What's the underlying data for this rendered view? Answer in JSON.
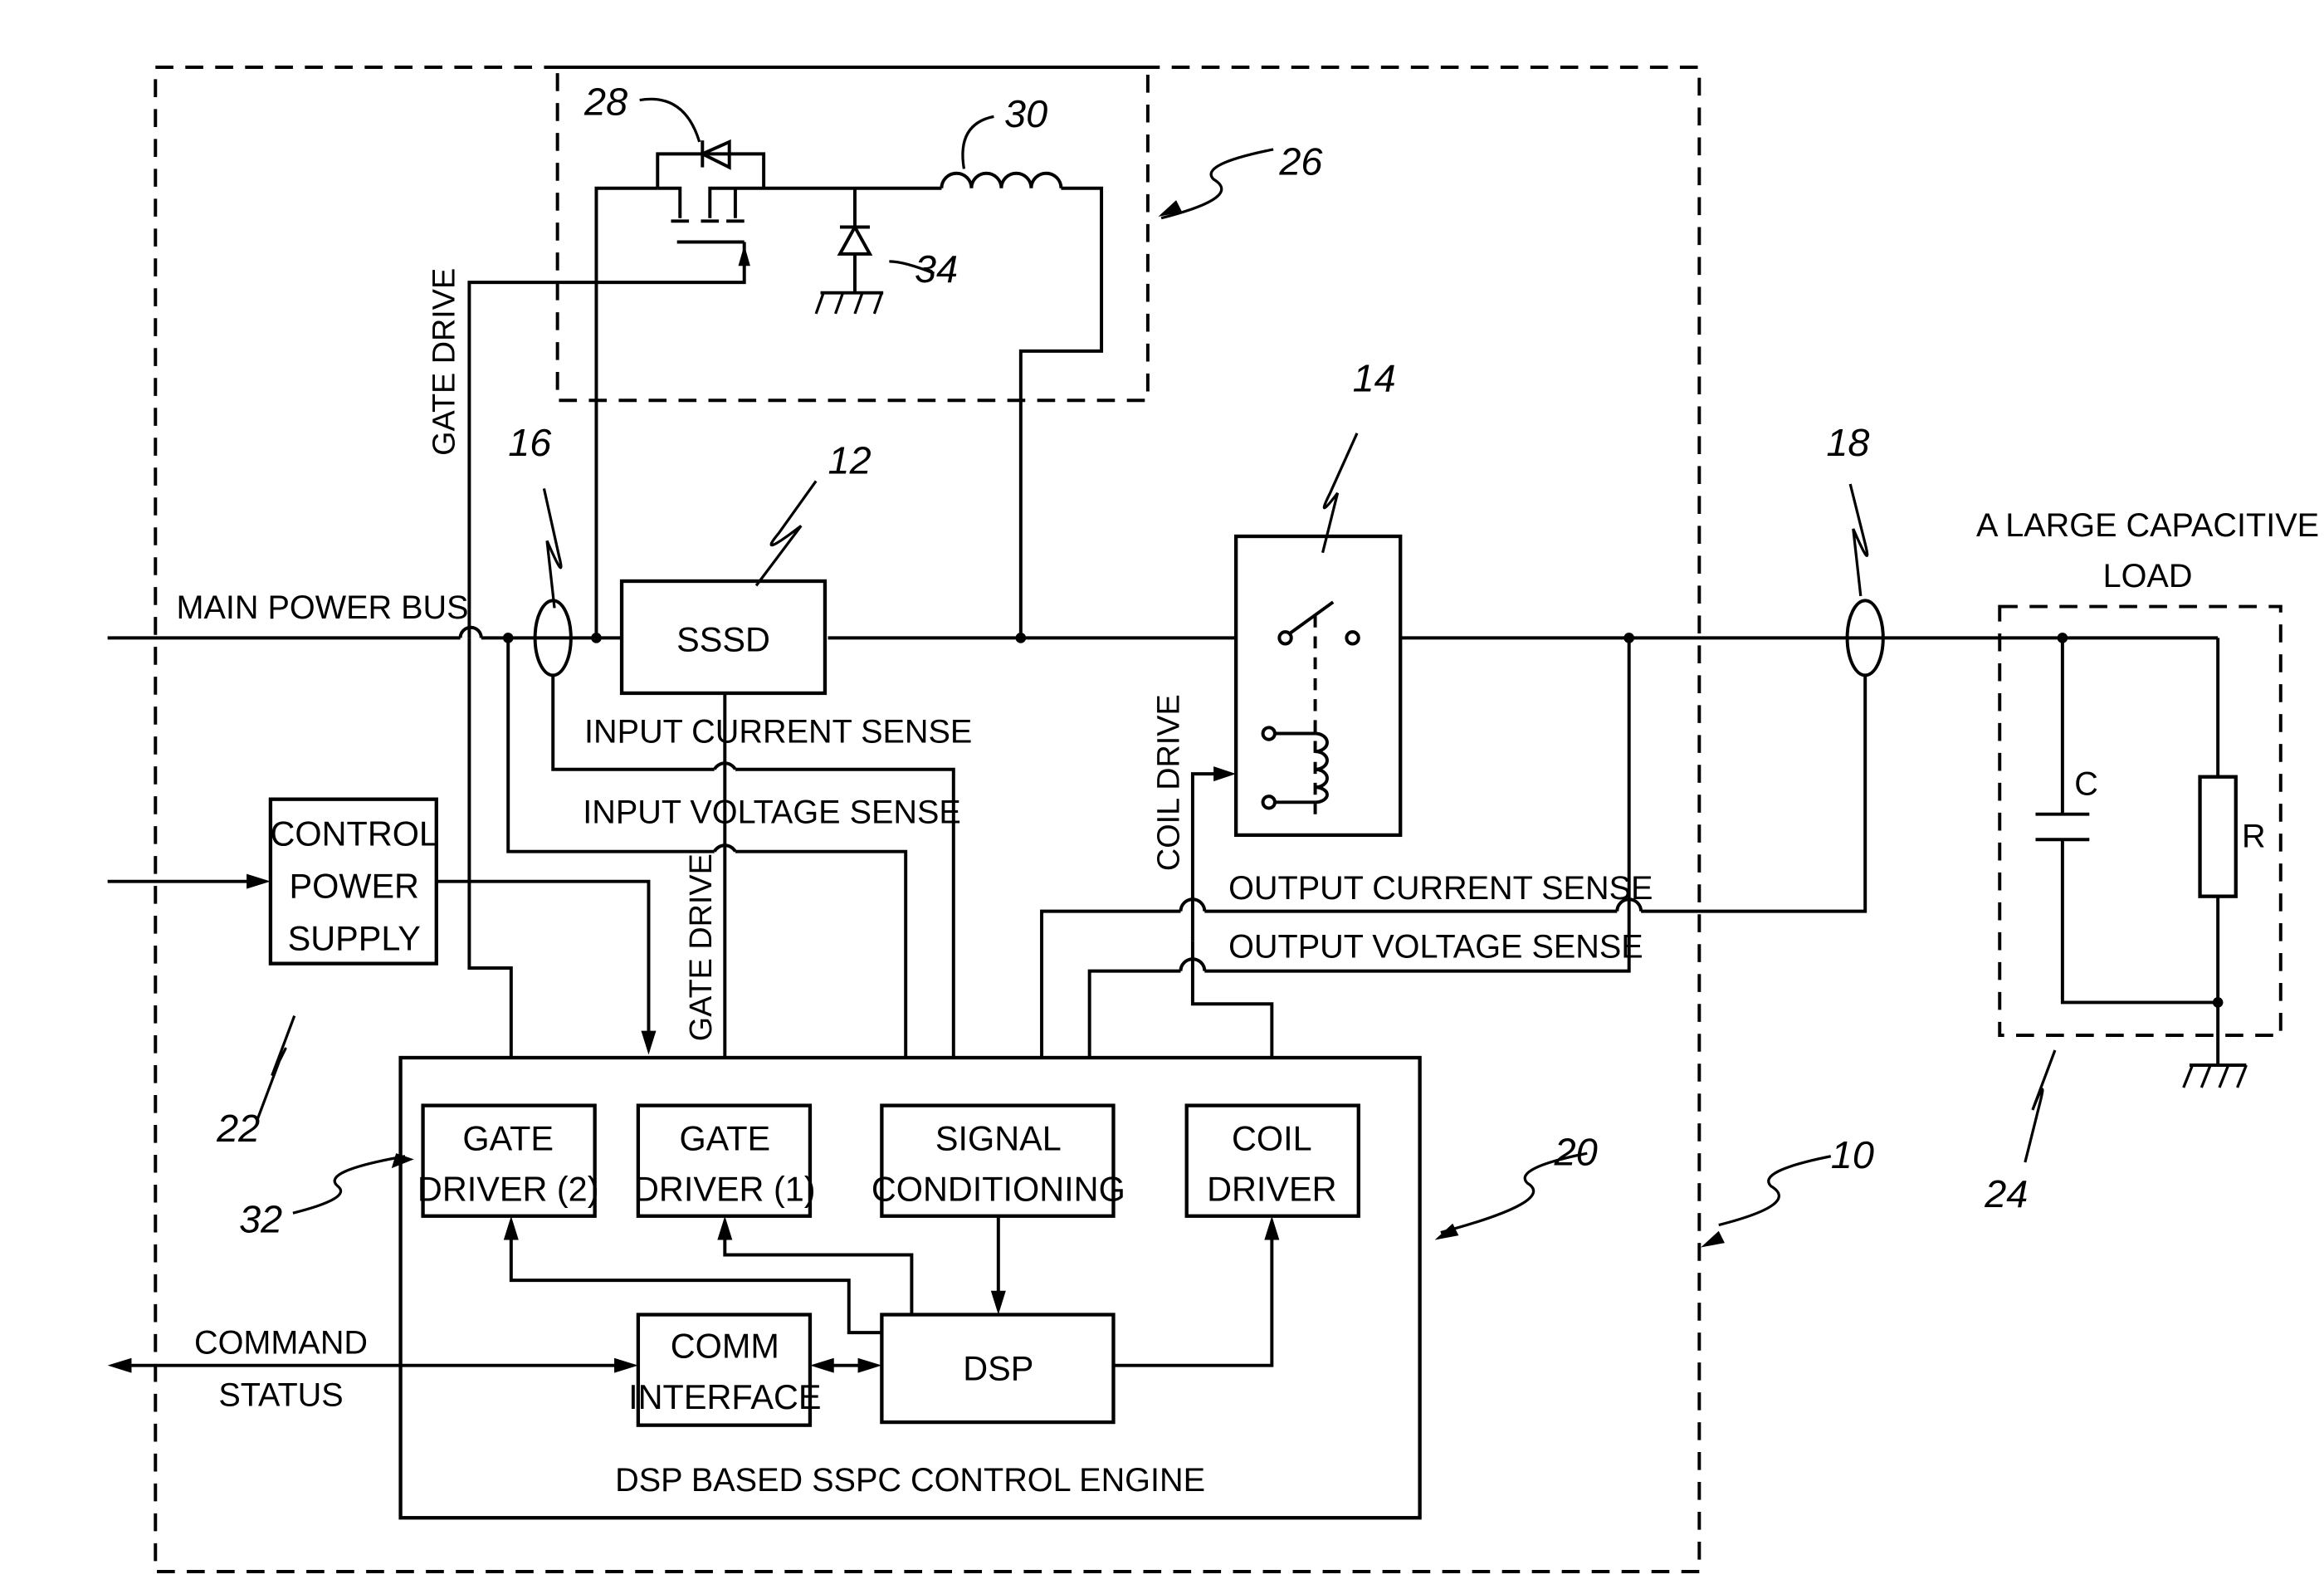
{
  "figure": {
    "labels": {
      "main_power_bus": "MAIN POWER BUS",
      "gate_drive_top": "GATE DRIVE",
      "gate_drive_mid": "GATE DRIVE",
      "coil_drive": "COIL DRIVE",
      "input_current_sense": "INPUT CURRENT SENSE",
      "input_voltage_sense": "INPUT VOLTAGE SENSE",
      "output_current_sense": "OUTPUT CURRENT SENSE",
      "output_voltage_sense": "OUTPUT VOLTAGE SENSE",
      "command": "COMMAND",
      "status": "STATUS",
      "load_title_1": "A LARGE CAPACITIVE",
      "load_title_2": "LOAD",
      "cap": "C",
      "res": "R",
      "engine": "DSP BASED SSPC CONTROL ENGINE"
    },
    "blocks": {
      "sssd": "SSSD",
      "cps": [
        "CONTROL",
        "POWER",
        "SUPPLY"
      ],
      "gate_driver_2": [
        "GATE",
        "DRIVER (2)"
      ],
      "gate_driver_1": [
        "GATE",
        "DRIVER (1)"
      ],
      "signal_conditioning": [
        "SIGNAL",
        "CONDITIONING"
      ],
      "coil_driver": [
        "COIL",
        "DRIVER"
      ],
      "comm_interface": [
        "COMM",
        "INTERFACE"
      ],
      "dsp": "DSP"
    },
    "refs": {
      "r10": "10",
      "r12": "12",
      "r14": "14",
      "r16": "16",
      "r18": "18",
      "r20": "20",
      "r22": "22",
      "r24": "24",
      "r26": "26",
      "r28": "28",
      "r30": "30",
      "r32": "32",
      "r34": "34"
    }
  }
}
